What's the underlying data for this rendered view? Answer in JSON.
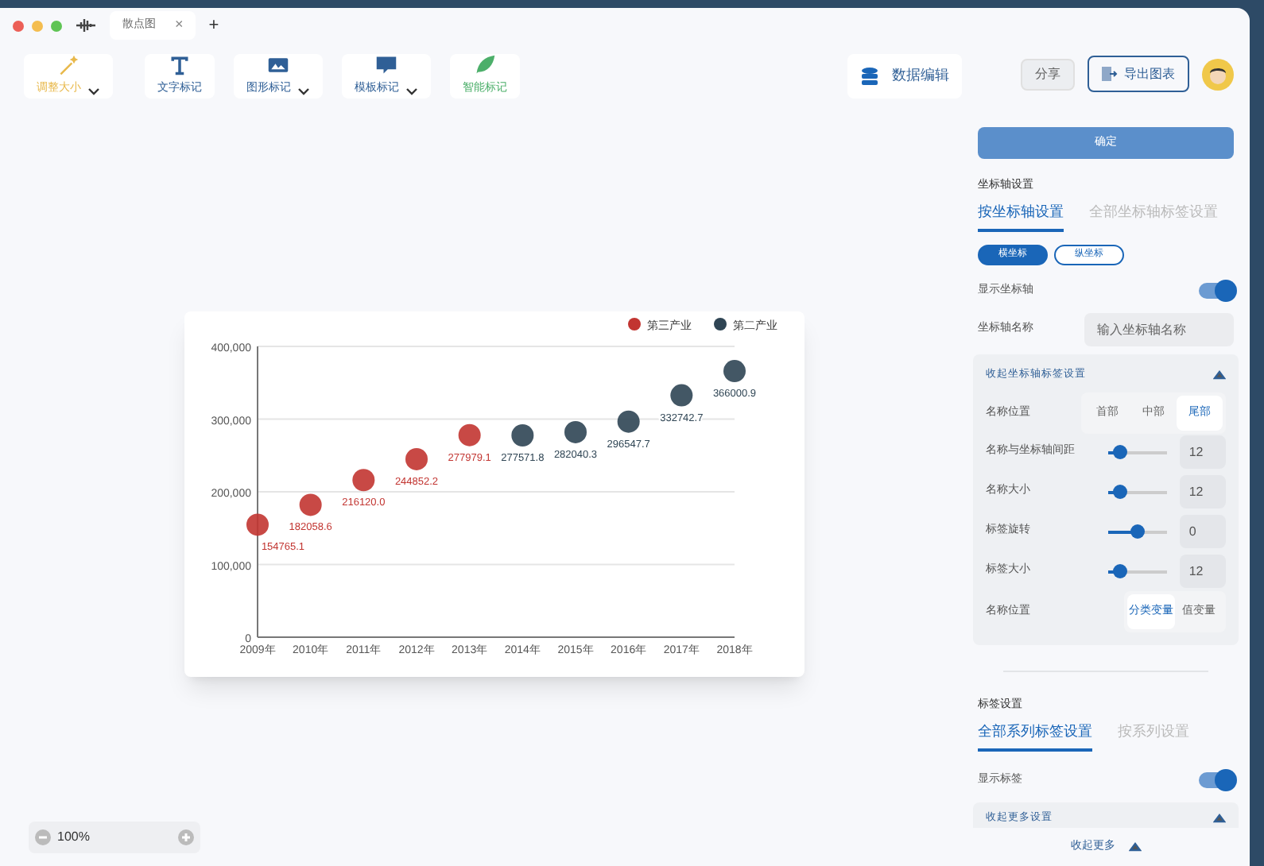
{
  "window": {
    "tab_title": "散点图",
    "tab_close": "×",
    "new_tab": "+"
  },
  "toolbar": [
    {
      "label": "调整大小",
      "kind": "wand",
      "color": "#e8b84a",
      "dropdown": true
    },
    {
      "label": "文字标记",
      "kind": "text",
      "color": "#2f5f96",
      "dropdown": false
    },
    {
      "label": "图形标记",
      "kind": "image",
      "color": "#2f5f96",
      "dropdown": true
    },
    {
      "label": "模板标记",
      "kind": "template",
      "color": "#2f5f96",
      "dropdown": true
    },
    {
      "label": "智能标记",
      "kind": "leaf",
      "color": "#4caf6a",
      "dropdown": false
    }
  ],
  "data_edit": "数据编辑",
  "share": "分享",
  "export": "导出图表",
  "chart_data": {
    "type": "scatter",
    "categories": [
      "2009年",
      "2010年",
      "2011年",
      "2012年",
      "2013年",
      "2014年",
      "2015年",
      "2016年",
      "2017年",
      "2018年"
    ],
    "series": [
      {
        "name": "第三产业",
        "color": "#c23531",
        "values": [
          154765.1,
          182058.6,
          216120,
          244852.2,
          277979.1,
          null,
          null,
          null,
          null,
          null
        ],
        "value_labels": [
          "154765.1",
          "182058.6",
          "216120.0",
          "244852.2",
          "277979.1",
          null,
          null,
          null,
          null,
          null
        ]
      },
      {
        "name": "第二产业",
        "color": "#2f4554",
        "values": [
          null,
          null,
          null,
          null,
          null,
          277571.8,
          282040.3,
          296547.7,
          332742.7,
          366000.9
        ],
        "value_labels": [
          null,
          null,
          null,
          null,
          null,
          "277571.8",
          "282040.3",
          "296547.7",
          "332742.7",
          "366000.9"
        ]
      }
    ],
    "grid": true,
    "legend": "top-right",
    "ylim": [
      0,
      400000
    ],
    "yticks": [
      {
        "value": 0,
        "label": "0"
      },
      {
        "value": 100000,
        "label": "100,000"
      },
      {
        "value": 200000,
        "label": "200,000"
      },
      {
        "value": 300000,
        "label": "300,000"
      },
      {
        "value": 400000,
        "label": "400,000"
      }
    ]
  },
  "zoom": {
    "value": "100%"
  },
  "panel": {
    "confirm": "确定",
    "axis_title": "坐标轴设置",
    "axis_tabs": [
      {
        "label": "按坐标轴设置",
        "selected": true
      },
      {
        "label": "全部坐标轴标签设置",
        "selected": false
      }
    ],
    "axis_pills": [
      {
        "label": "横坐标",
        "selected": true
      },
      {
        "label": "纵坐标",
        "selected": false
      }
    ],
    "show_axis": {
      "label": "显示坐标轴",
      "on": true
    },
    "axis_name": {
      "label": "坐标轴名称",
      "placeholder": "输入坐标轴名称"
    },
    "label_section": {
      "title": "收起坐标轴标签设置",
      "expanded": true,
      "name_position": {
        "label": "名称位置",
        "options": [
          {
            "label": "首部",
            "selected": false
          },
          {
            "label": "中部",
            "selected": false
          },
          {
            "label": "尾部",
            "selected": true
          }
        ]
      },
      "sliders": [
        {
          "label": "名称与坐标轴间距",
          "level": 0.1,
          "reading": "12"
        },
        {
          "label": "名称大小",
          "level": 0.1,
          "reading": "12"
        },
        {
          "label": "标签旋转",
          "level": 0.5,
          "reading": "0"
        },
        {
          "label": "标签大小",
          "level": 0.1,
          "reading": "12"
        }
      ],
      "variable": {
        "label": "名称位置",
        "options": [
          {
            "label": "分类变量",
            "selected": true
          },
          {
            "label": "值变量",
            "selected": false
          }
        ]
      }
    },
    "label_title": "标签设置",
    "label_tabs": [
      {
        "label": "全部系列标签设置",
        "selected": true
      },
      {
        "label": "按系列设置",
        "selected": false
      }
    ],
    "show_labels": {
      "label": "显示标签",
      "on": true
    },
    "more_section": {
      "title": "收起更多设置",
      "expanded": true
    },
    "footer": "收起更多"
  }
}
